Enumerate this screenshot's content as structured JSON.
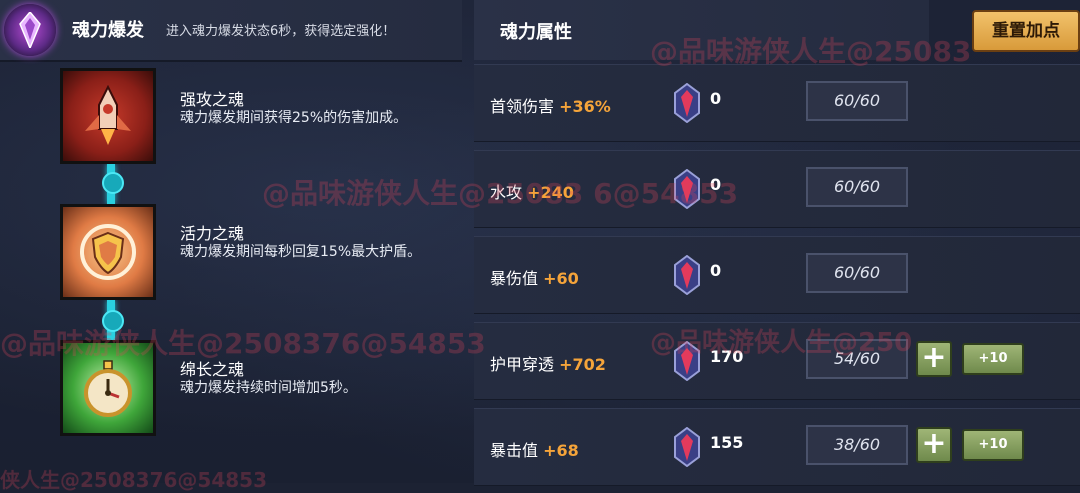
{
  "header": {
    "title": "魂力爆发",
    "description": "进入魂力爆发状态6秒，获得选定强化！"
  },
  "skills": [
    {
      "name": "强攻之魂",
      "desc": "魂力爆发期间获得25%的伤害加成。",
      "icon": "rocket-icon"
    },
    {
      "name": "活力之魂",
      "desc": "魂力爆发期间每秒回复15%最大护盾。",
      "icon": "shield-icon"
    },
    {
      "name": "绵长之魂",
      "desc": "魂力爆发持续时间增加5秒。",
      "icon": "stopwatch-icon"
    }
  ],
  "attributes_panel": {
    "title": "魂力属性",
    "reset_label": "重置加点",
    "rows": [
      {
        "label": "首领伤害",
        "bonus": "+36%",
        "gems": "0",
        "value": "60/60",
        "upgradeable": false
      },
      {
        "label": "水攻",
        "bonus": "+240",
        "gems": "0",
        "value": "60/60",
        "upgradeable": false
      },
      {
        "label": "暴伤值",
        "bonus": "+60",
        "gems": "0",
        "value": "60/60",
        "upgradeable": false
      },
      {
        "label": "护甲穿透",
        "bonus": "+702",
        "gems": "170",
        "value": "54/60",
        "upgradeable": true,
        "plus_label": "+",
        "plus10_label": "+10"
      },
      {
        "label": "暴击值",
        "bonus": "+68",
        "gems": "155",
        "value": "38/60",
        "upgradeable": true,
        "plus_label": "+",
        "plus10_label": "+10"
      }
    ]
  },
  "watermark": {
    "text_full": "@品味游侠人生@2508376@54853",
    "text_b": "@品味游侠人生@25083",
    "text_c": "@品味游侠人生@25083 6@54853",
    "text_d": "侠人生@2508376@54853",
    "text_e": "@品味游侠人生@250"
  },
  "colors": {
    "bonus": "#f5a43a",
    "connector": "#2ad0e0",
    "reset_button": "#e3a94c",
    "plus_button": "#8aa35f"
  }
}
